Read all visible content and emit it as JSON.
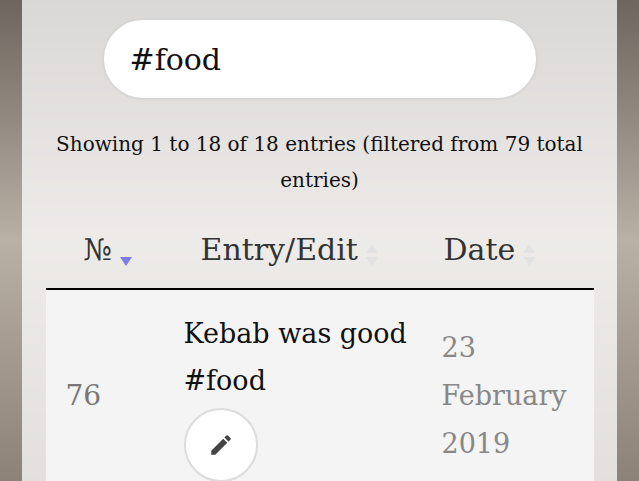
{
  "search": {
    "value": "#food"
  },
  "info": "Showing 1 to 18 of 18 entries (filtered from 79 total entries)",
  "table": {
    "columns": [
      {
        "label": "№",
        "sort": "desc"
      },
      {
        "label": "Entry/Edit",
        "sort": "none"
      },
      {
        "label": "Date",
        "sort": "none"
      }
    ],
    "rows": [
      {
        "number": "76",
        "entry": "Kebab was good #food",
        "date": "23 February 2019"
      }
    ]
  }
}
